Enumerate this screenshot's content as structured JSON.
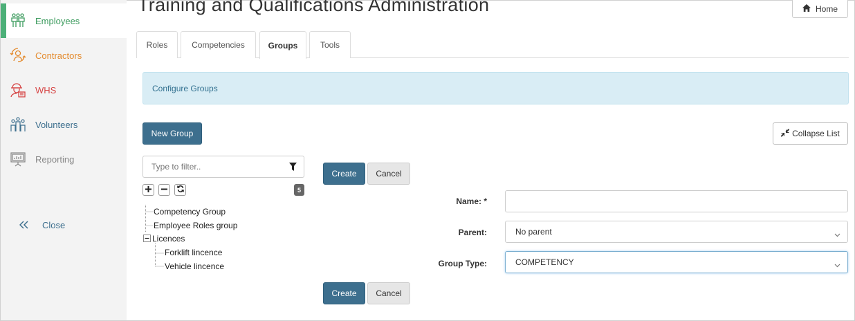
{
  "sidebar": {
    "items": [
      {
        "label": "Employees",
        "icon": "employees-icon",
        "color": "#3a9a5c",
        "active": true
      },
      {
        "label": "Contractors",
        "icon": "contractors-icon",
        "color": "#e48a2c"
      },
      {
        "label": "WHS",
        "icon": "whs-icon",
        "color": "#d64545"
      },
      {
        "label": "Volunteers",
        "icon": "volunteers-icon",
        "color": "#3d6f8e"
      },
      {
        "label": "Reporting",
        "icon": "reporting-icon",
        "color": "#888888"
      }
    ],
    "close_label": "Close"
  },
  "header": {
    "title": "Training and Qualifications Administration",
    "home_label": "Home"
  },
  "tabs": [
    {
      "label": "Roles"
    },
    {
      "label": "Competencies"
    },
    {
      "label": "Groups",
      "active": true
    },
    {
      "label": "Tools"
    }
  ],
  "banner": {
    "text": "Configure Groups"
  },
  "actions": {
    "new_group_label": "New Group",
    "collapse_list_label": "Collapse List",
    "create_label": "Create",
    "cancel_label": "Cancel"
  },
  "filter": {
    "placeholder": "Type to filter..",
    "value": ""
  },
  "tree": {
    "count": "5",
    "items": [
      {
        "label": "Competency Group"
      },
      {
        "label": "Employee Roles group"
      },
      {
        "label": "Licences",
        "expanded": true
      },
      {
        "label": "Forklift lincence"
      },
      {
        "label": "Vehicle lincence"
      }
    ]
  },
  "form": {
    "name_label": "Name: *",
    "name_value": "",
    "parent_label": "Parent:",
    "parent_value": "No parent",
    "group_type_label": "Group Type:",
    "group_type_value": "COMPETENCY"
  },
  "colors": {
    "primary": "#3d6f8e",
    "banner_bg": "#d9edf5",
    "sidebar_bg": "#f3f3f3",
    "active_marker": "#4caf78"
  }
}
